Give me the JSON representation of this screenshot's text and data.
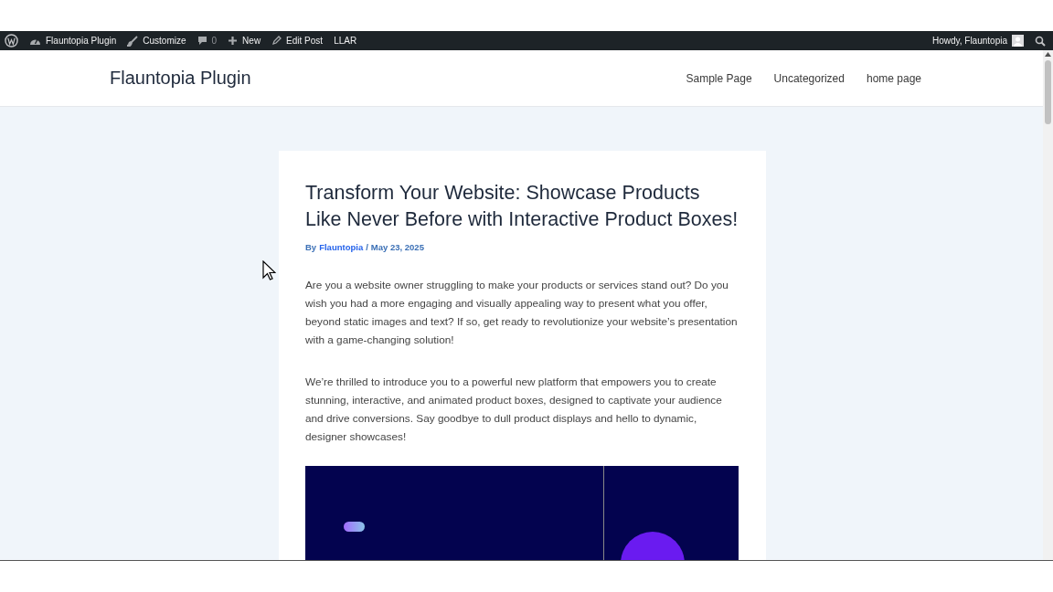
{
  "admin_bar": {
    "items": [
      {
        "kind": "wp-logo"
      },
      {
        "kind": "site",
        "label": "Flauntopia Plugin"
      },
      {
        "kind": "customize",
        "label": "Customize"
      },
      {
        "kind": "comments",
        "label": "0"
      },
      {
        "kind": "new",
        "label": "New"
      },
      {
        "kind": "edit",
        "label": "Edit Post"
      },
      {
        "kind": "text",
        "label": "LLAR"
      }
    ],
    "greeting": "Howdy, Flauntopia"
  },
  "header": {
    "site_title": "Flauntopia Plugin",
    "nav": [
      "Sample Page",
      "Uncategorized",
      "home page"
    ]
  },
  "post": {
    "title": "Transform Your Website: Showcase Products Like Never Before with Interactive Product Boxes!",
    "byline": "By",
    "author": "Flauntopia",
    "separator": "/",
    "date": "May 23, 2025",
    "paragraphs": [
      "Are you a website owner struggling to make your products or services stand out? Do you wish you had a more engaging and visually appealing way to present what you offer, beyond static images and text? If so, get ready to revolutionize your website’s presentation with a game-changing solution!",
      "We’re thrilled to introduce you to a powerful new platform that empowers you to create stunning, interactive, and animated product boxes, designed to captivate your audience and drive conversions. Say goodbye to dull product displays and hello to dynamic, designer showcases!"
    ]
  }
}
